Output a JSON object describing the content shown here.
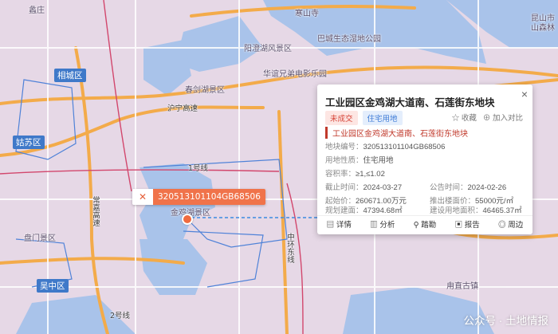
{
  "map": {
    "labels": {
      "xiaozhuang": "蠡庄",
      "hanshansi": "寒山寺",
      "yangcheng_scenic": "阳澄湖风景区",
      "bacheng_park": "巴城生态湿地公园",
      "kunshan": "昆山市",
      "senlin": "山森林",
      "xiangcheng": "相城区",
      "huaxiang": "华谊兄弟电影乐园",
      "chunjianhu": "春剑湖景区",
      "huhu_gaosu": "沪宁高速",
      "gusu": "姑苏区",
      "line1": "1号线",
      "changjiatang": "常嘉高速",
      "jinjihu_scenic": "金鸡湖景区",
      "zhongdong": "中环东线",
      "panmen": "盘门景区",
      "wuzhong": "吴中区",
      "line2": "2号线",
      "yongzhi": "甪直古镇"
    }
  },
  "plot_tag": {
    "icon": "plot-marker-icon",
    "id": "320513101104GB68506"
  },
  "card": {
    "title": "工业园区金鸡湖大道南、石莲街东地块",
    "badges": {
      "status": "未成交",
      "use": "住宅用地"
    },
    "actions": {
      "favorite": "☆ 收藏",
      "compare": "⊕ 加入对比"
    },
    "subtitle": "工业园区金鸡湖大道南、石莲街东地块",
    "fields": {
      "plot_no_label": "地块编号：",
      "plot_no": "320513101104GB68506",
      "use_label": "用地性质：",
      "use": "住宅用地",
      "far_label": "容积率：",
      "far": "≥1,≤1.02",
      "deadline_label": "截止时间：",
      "deadline": "2024-03-27",
      "announce_label": "公告时间：",
      "announce": "2024-02-26",
      "start_price_label": "起始价：",
      "start_price": "260671.00万元",
      "floor_price_label": "推出楼面价：",
      "floor_price": "55000元/㎡",
      "plan_area_label": "规划建面：",
      "plan_area": "47394.68㎡",
      "site_area_label": "建设用地面积：",
      "site_area": "46465.37㎡"
    },
    "footer": {
      "detail": "详情",
      "analysis": "分析",
      "survey": "踏勘",
      "report": "报告",
      "nearby": "周边"
    },
    "close": "×"
  },
  "watermark": "公众号 · 土地情报",
  "colors": {
    "accent": "#f0734a",
    "status_red": "#d7463a",
    "use_blue": "#3c7ad6",
    "water": "#a9c3ea",
    "land": "#e6d8e6"
  }
}
